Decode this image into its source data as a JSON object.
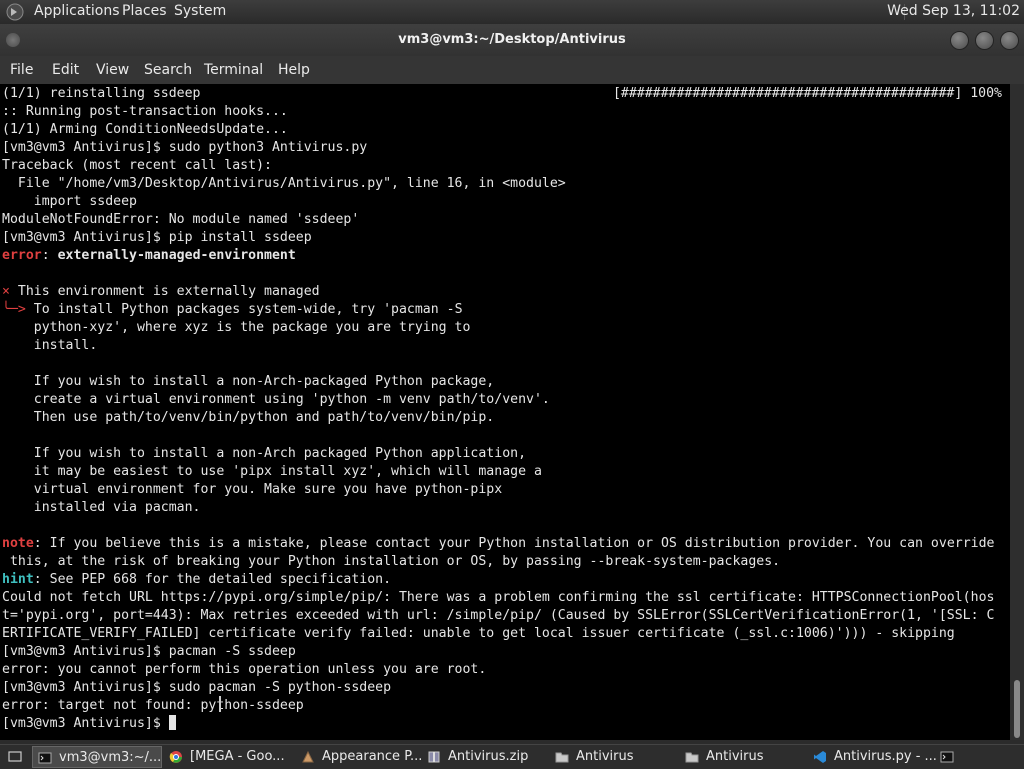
{
  "top_panel": {
    "menus": [
      "Applications",
      "Places",
      "System"
    ],
    "clock": "Wed Sep 13, 11:02"
  },
  "window": {
    "title": "vm3@vm3:~/Desktop/Antivirus"
  },
  "menubar": [
    "File",
    "Edit",
    "View",
    "Search",
    "Terminal",
    "Help"
  ],
  "terminal": {
    "progress": "[##########################################] 100%",
    "lines": [
      {
        "segments": [
          {
            "t": "(1/1) reinstalling ssdeep"
          }
        ]
      },
      {
        "segments": [
          {
            "t": ":: Running post-transaction hooks..."
          }
        ]
      },
      {
        "segments": [
          {
            "t": "(1/1) Arming ConditionNeedsUpdate..."
          }
        ]
      },
      {
        "segments": [
          {
            "t": "[vm3@vm3 Antivirus]$ sudo python3 Antivirus.py"
          }
        ]
      },
      {
        "segments": [
          {
            "t": "Traceback (most recent call last):"
          }
        ]
      },
      {
        "segments": [
          {
            "t": "  File \"/home/vm3/Desktop/Antivirus/Antivirus.py\", line 16, in <module>"
          }
        ]
      },
      {
        "segments": [
          {
            "t": "    import ssdeep"
          }
        ]
      },
      {
        "segments": [
          {
            "t": "ModuleNotFoundError: No module named 'ssdeep'"
          }
        ]
      },
      {
        "segments": [
          {
            "t": "[vm3@vm3 Antivirus]$ pip install ssdeep"
          }
        ]
      },
      {
        "segments": [
          {
            "t": "error",
            "c": "red bold"
          },
          {
            "t": ": "
          },
          {
            "t": "externally-managed-environment",
            "c": "bold"
          }
        ]
      },
      {
        "segments": [
          {
            "t": ""
          }
        ]
      },
      {
        "segments": [
          {
            "t": "×",
            "c": "red"
          },
          {
            "t": " This environment is externally managed"
          }
        ]
      },
      {
        "segments": [
          {
            "t": "╰─>",
            "c": "red"
          },
          {
            "t": " To install Python packages system-wide, try 'pacman -S"
          }
        ]
      },
      {
        "segments": [
          {
            "t": "    python-xyz', where xyz is the package you are trying to"
          }
        ]
      },
      {
        "segments": [
          {
            "t": "    install."
          }
        ]
      },
      {
        "segments": [
          {
            "t": ""
          }
        ]
      },
      {
        "segments": [
          {
            "t": "    If you wish to install a non-Arch-packaged Python package,"
          }
        ]
      },
      {
        "segments": [
          {
            "t": "    create a virtual environment using 'python -m venv path/to/venv'."
          }
        ]
      },
      {
        "segments": [
          {
            "t": "    Then use path/to/venv/bin/python and path/to/venv/bin/pip."
          }
        ]
      },
      {
        "segments": [
          {
            "t": ""
          }
        ]
      },
      {
        "segments": [
          {
            "t": "    If you wish to install a non-Arch packaged Python application,"
          }
        ]
      },
      {
        "segments": [
          {
            "t": "    it may be easiest to use 'pipx install xyz', which will manage a"
          }
        ]
      },
      {
        "segments": [
          {
            "t": "    virtual environment for you. Make sure you have python-pipx"
          }
        ]
      },
      {
        "segments": [
          {
            "t": "    installed via pacman."
          }
        ]
      },
      {
        "segments": [
          {
            "t": ""
          }
        ]
      },
      {
        "segments": [
          {
            "t": "note",
            "c": "red bold"
          },
          {
            "t": ": If you believe this is a mistake, please contact your Python installation or OS distribution provider. You can override"
          }
        ]
      },
      {
        "segments": [
          {
            "t": " this, at the risk of breaking your Python installation or OS, by passing --break-system-packages."
          }
        ]
      },
      {
        "segments": [
          {
            "t": "hint",
            "c": "hint"
          },
          {
            "t": ": See PEP 668 for the detailed specification."
          }
        ]
      },
      {
        "segments": [
          {
            "t": "Could not fetch URL https://pypi.org/simple/pip/: There was a problem confirming the ssl certificate: HTTPSConnectionPool(hos"
          }
        ]
      },
      {
        "segments": [
          {
            "t": "t='pypi.org', port=443): Max retries exceeded with url: /simple/pip/ (Caused by SSLError(SSLCertVerificationError(1, '[SSL: C"
          }
        ]
      },
      {
        "segments": [
          {
            "t": "ERTIFICATE_VERIFY_FAILED] certificate verify failed: unable to get local issuer certificate (_ssl.c:1006)'))) - skipping"
          }
        ]
      },
      {
        "segments": [
          {
            "t": "[vm3@vm3 Antivirus]$ pacman -S ssdeep"
          }
        ]
      },
      {
        "segments": [
          {
            "t": "error: you cannot perform this operation unless you are root."
          }
        ]
      },
      {
        "segments": [
          {
            "t": "[vm3@vm3 Antivirus]$ sudo pacman -S python-ssdeep"
          }
        ]
      },
      {
        "segments": [
          {
            "t": "error: target not found: python-ssdeep"
          }
        ]
      },
      {
        "segments": [
          {
            "t": "[vm3@vm3 Antivirus]$ "
          }
        ],
        "cursor": true
      }
    ]
  },
  "taskbar": {
    "items": [
      {
        "label": "vm3@vm3:~/...",
        "icon": "terminal-icon",
        "active": true
      },
      {
        "label": "[MEGA - Goo...",
        "icon": "chrome-icon",
        "active": false
      },
      {
        "label": "Appearance P...",
        "icon": "appearance-icon",
        "active": false
      },
      {
        "label": "Antivirus.zip",
        "icon": "archive-icon",
        "active": false
      },
      {
        "label": "Antivirus",
        "icon": "folder-icon",
        "active": false
      },
      {
        "label": "Antivirus",
        "icon": "folder-icon",
        "active": false
      },
      {
        "label": "Antivirus.py - ...",
        "icon": "vscode-icon",
        "active": false
      }
    ],
    "tray_icon": "terminal-icon"
  }
}
